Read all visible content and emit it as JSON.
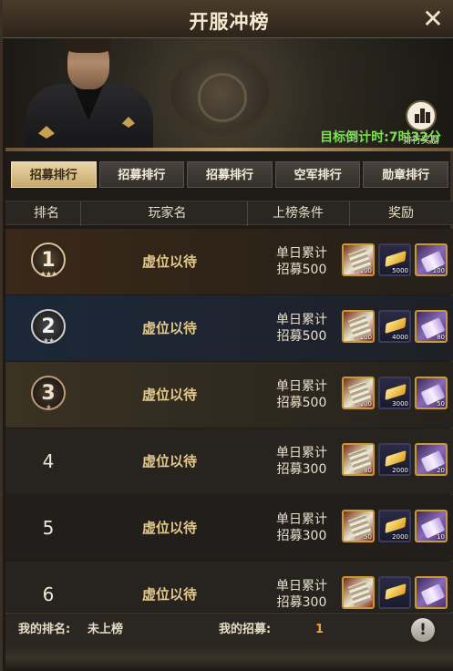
{
  "header": {
    "title": "开服冲榜",
    "close_icon": "close-icon",
    "reward_button_label": "排行奖励",
    "countdown": "目标倒计时:7时32分"
  },
  "tabs": [
    {
      "label": "招募排行",
      "active": true
    },
    {
      "label": "招募排行",
      "active": false
    },
    {
      "label": "招募排行",
      "active": false
    },
    {
      "label": "空军排行",
      "active": false
    },
    {
      "label": "勋章排行",
      "active": false
    }
  ],
  "columns": {
    "rank": "排名",
    "player": "玩家名",
    "condition": "上榜条件",
    "reward": "奖励"
  },
  "rows": [
    {
      "rank": "1",
      "player": "虚位以待",
      "condition_line1": "单日累计",
      "condition_line2": "招募500",
      "rewards": [
        "100",
        "5000",
        "100"
      ]
    },
    {
      "rank": "2",
      "player": "虚位以待",
      "condition_line1": "单日累计",
      "condition_line2": "招募500",
      "rewards": [
        "100",
        "4000",
        "80"
      ]
    },
    {
      "rank": "3",
      "player": "虚位以待",
      "condition_line1": "单日累计",
      "condition_line2": "招募500",
      "rewards": [
        "100",
        "3000",
        "50"
      ]
    },
    {
      "rank": "4",
      "player": "虚位以待",
      "condition_line1": "单日累计",
      "condition_line2": "招募300",
      "rewards": [
        "80",
        "2000",
        "20"
      ]
    },
    {
      "rank": "5",
      "player": "虚位以待",
      "condition_line1": "单日累计",
      "condition_line2": "招募300",
      "rewards": [
        "50",
        "2000",
        "10"
      ]
    },
    {
      "rank": "6",
      "player": "虚位以待",
      "condition_line1": "单日累计",
      "condition_line2": "招募300",
      "rewards": [
        "",
        "",
        ""
      ]
    }
  ],
  "footer": {
    "my_rank_label": "我的排名:",
    "my_rank_value": "未上榜",
    "my_recruit_label": "我的招募:",
    "my_recruit_value": "1",
    "info_icon": "info-icon"
  },
  "colors": {
    "countdown": "#7fe05a",
    "tab_active": "#e8d6a8",
    "player_name": "#e4c98c",
    "row1_bg": "#3a2a1e",
    "row2_bg": "#1e2a38",
    "row3_bg": "#3a3122"
  }
}
